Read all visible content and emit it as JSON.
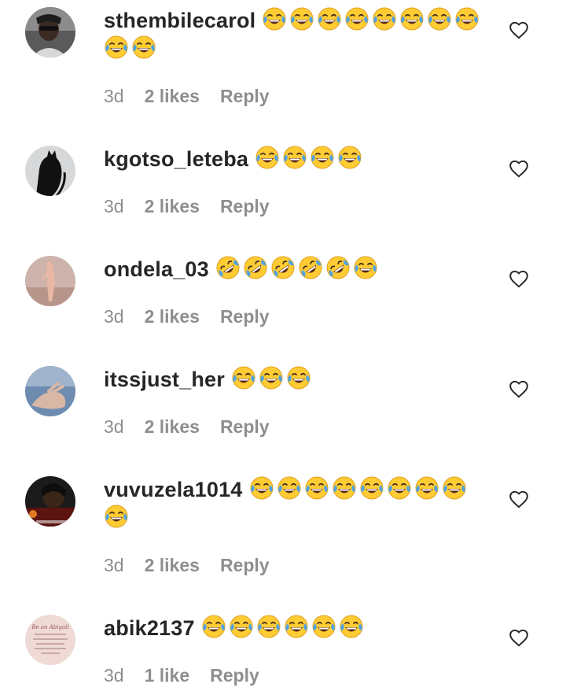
{
  "comments": [
    {
      "username": "sthembilecarol",
      "emojis": [
        "laugh-emoji",
        "laugh-emoji",
        "laugh-emoji",
        "laugh-emoji",
        "laugh-emoji",
        "laugh-emoji",
        "laugh-emoji",
        "laugh-emoji",
        "laugh-emoji",
        "laugh-emoji"
      ],
      "time": "3d",
      "likes": "2 likes",
      "reply": "Reply",
      "avatar_color": "#3a3a3a"
    },
    {
      "username": "kgotso_leteba",
      "emojis": [
        "laugh-emoji",
        "laugh-emoji",
        "laugh-emoji",
        "laugh-emoji"
      ],
      "time": "3d",
      "likes": "2 likes",
      "reply": "Reply",
      "avatar_color": "#cfd0d2"
    },
    {
      "username": "ondela_03",
      "emojis": [
        "rofl-emoji",
        "rofl-emoji",
        "rofl-emoji",
        "rofl-emoji",
        "rofl-emoji",
        "laugh-emoji"
      ],
      "time": "3d",
      "likes": "2 likes",
      "reply": "Reply",
      "avatar_color": "#c7a79e"
    },
    {
      "username": "itssjust_her",
      "emojis": [
        "laugh-emoji",
        "laugh-emoji",
        "laugh-emoji"
      ],
      "time": "3d",
      "likes": "2 likes",
      "reply": "Reply",
      "avatar_color": "#6f8fb3"
    },
    {
      "username": "vuvuzela1014",
      "emojis": [
        "laugh-emoji",
        "laugh-emoji",
        "laugh-emoji",
        "laugh-emoji",
        "laugh-emoji",
        "laugh-emoji",
        "laugh-emoji",
        "laugh-emoji",
        "laugh-emoji"
      ],
      "time": "3d",
      "likes": "2 likes",
      "reply": "Reply",
      "avatar_color": "#1a1a1a"
    },
    {
      "username": "abik2137",
      "emojis": [
        "laugh-emoji",
        "laugh-emoji",
        "laugh-emoji",
        "laugh-emoji",
        "laugh-emoji",
        "laugh-emoji"
      ],
      "time": "3d",
      "likes": "1 like",
      "reply": "Reply",
      "avatar_color": "#efd9d6",
      "avatar_text": "Be an Abigail"
    }
  ],
  "colors": {
    "username": "#262626",
    "meta": "#8e8e8e",
    "heart_stroke": "#262626",
    "emoji_face": "#FFCC33",
    "emoji_tears": "#4FA3E6"
  },
  "icons": {
    "like": "heart-outline-icon"
  }
}
